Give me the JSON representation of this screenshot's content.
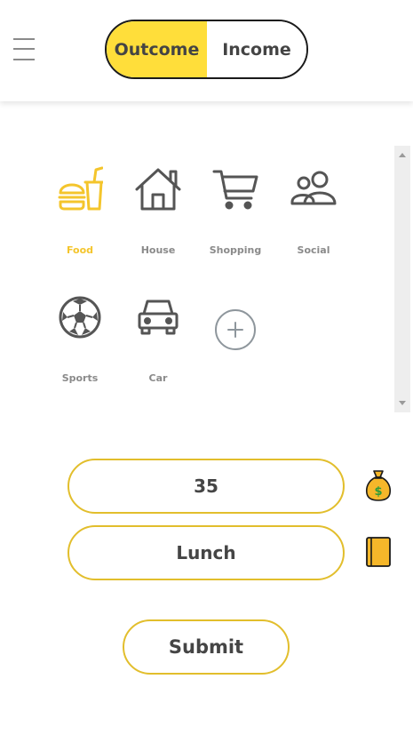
{
  "header": {
    "menu_icon": "hamburger-menu-icon",
    "toggle": {
      "outcome_label": "Outcome",
      "income_label": "Income",
      "selected": "Outcome"
    }
  },
  "colors": {
    "accent": "#ffde3a",
    "accent_border": "#e2be2c",
    "muted": "#8a8a8a",
    "text": "#454545"
  },
  "categories": [
    {
      "label": "Food",
      "icon": "fast-food-icon",
      "selected": true
    },
    {
      "label": "House",
      "icon": "house-icon",
      "selected": false
    },
    {
      "label": "Shopping",
      "icon": "shopping-cart-icon",
      "selected": false
    },
    {
      "label": "Social",
      "icon": "people-icon",
      "selected": false
    },
    {
      "label": "Sports",
      "icon": "soccer-ball-icon",
      "selected": false
    },
    {
      "label": "Car",
      "icon": "car-icon",
      "selected": false
    }
  ],
  "add_category_icon": "plus-circle-icon",
  "form": {
    "amount_value": "35",
    "amount_icon": "money-bag-icon",
    "description_value": "Lunch",
    "description_icon": "notebook-icon",
    "submit_label": "Submit"
  }
}
